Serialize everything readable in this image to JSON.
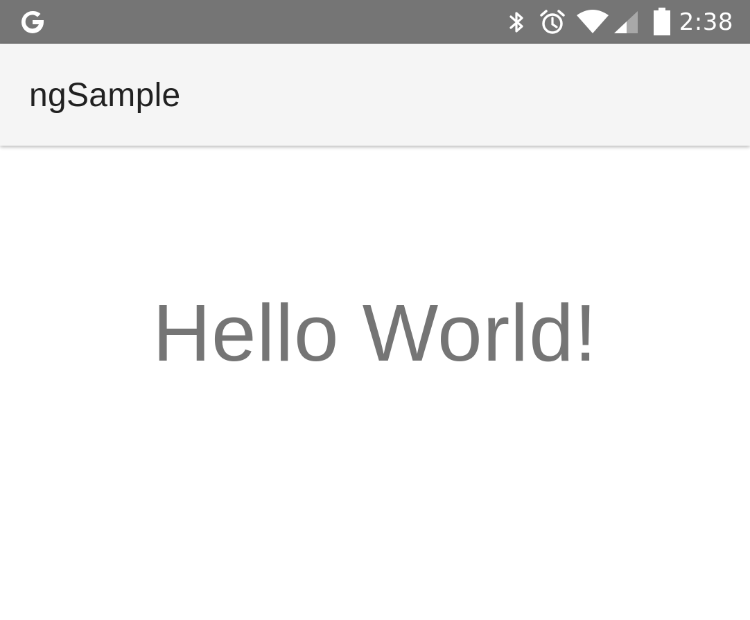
{
  "status_bar": {
    "time": "2:38",
    "left_icon": "google-g-icon",
    "icons": [
      "bluetooth-icon",
      "alarm-icon",
      "wifi-icon",
      "signal-icon",
      "battery-icon"
    ],
    "background_color": "#757575"
  },
  "app_bar": {
    "title": "ngSample",
    "background_color": "#f5f5f5"
  },
  "main": {
    "message": "Hello World!",
    "text_color": "#757575"
  }
}
